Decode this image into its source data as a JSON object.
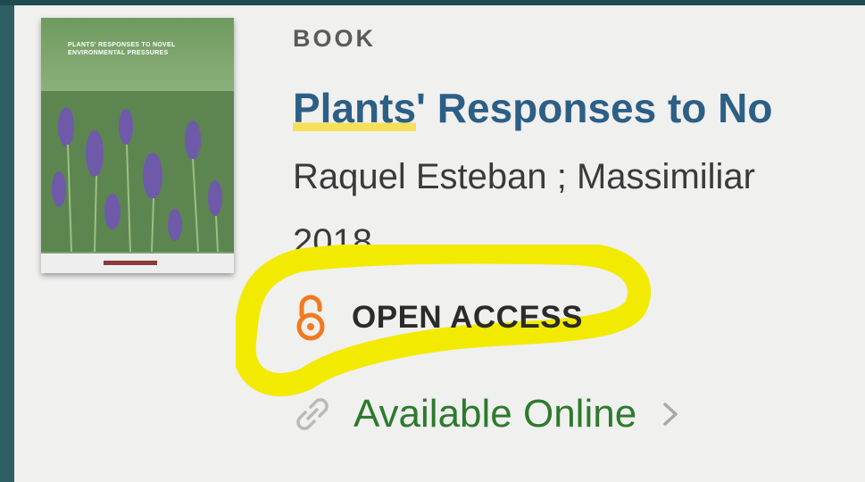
{
  "result": {
    "type_label": "BOOK",
    "title_highlighted": "Plants",
    "title_rest": "' Responses to No",
    "authors": "Raquel Esteban ; Massimiliar",
    "year": "2018",
    "open_access_label": "OPEN ACCESS",
    "availability_label": "Available Online",
    "cover": {
      "title": "PLANTS' RESPONSES TO NOVEL ENVIRONMENTAL PRESSURES"
    }
  },
  "colors": {
    "background": "#2f5f64",
    "card": "#f0f0ef",
    "title": "#2c5f86",
    "title_highlight": "#f6e05a",
    "open_access_icon": "#f07a1e",
    "availability": "#2d7a2d",
    "scribble": "#f2ea00"
  },
  "icons": {
    "open_access": "open-lock-icon",
    "availability": "link-icon",
    "chevron": "chevron-right-icon"
  }
}
